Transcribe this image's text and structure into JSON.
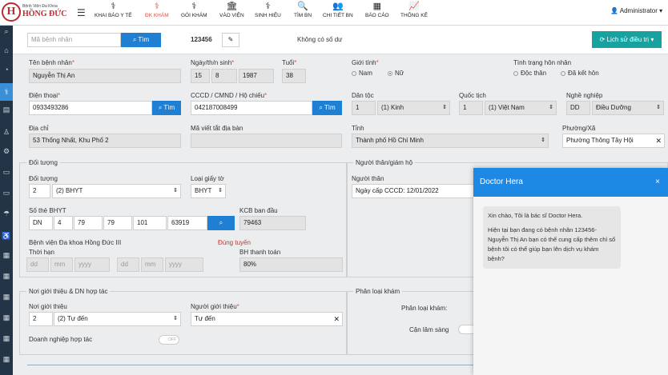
{
  "header": {
    "logo_letter": "H",
    "logo_line1": "Bệnh Viện Đa Khoa",
    "logo_line2": "HỒNG ĐỨC",
    "nav": [
      {
        "label": "KHAI BÁO Y TẾ",
        "icon": "stethoscope-icon",
        "glyph": "⚕"
      },
      {
        "label": "ĐK KHÁM",
        "icon": "stethoscope-icon",
        "glyph": "⚕"
      },
      {
        "label": "GÓI KHÁM",
        "icon": "stethoscope-icon",
        "glyph": "⚕"
      },
      {
        "label": "VÀO VIỆN",
        "icon": "hospital-icon",
        "glyph": "🏛"
      },
      {
        "label": "SINH HIỆU",
        "icon": "stethoscope-icon",
        "glyph": "⚕"
      },
      {
        "label": "TÌM BN",
        "icon": "search-icon",
        "glyph": "🔍"
      },
      {
        "label": "CHI TIẾT BN",
        "icon": "users-icon",
        "glyph": "👥"
      },
      {
        "label": "BÁO CÁO",
        "icon": "report-icon",
        "glyph": "▦"
      },
      {
        "label": "THỐNG KÊ",
        "icon": "chart-icon",
        "glyph": "📈"
      }
    ],
    "user": "Administrator"
  },
  "toolbar": {
    "patient_search_placeholder": "Mã bệnh nhân",
    "search_label": "Tìm",
    "patient_code": "123456",
    "balance_text": "Không có số dư",
    "history_label": "Lịch sử điều trị"
  },
  "patient": {
    "name_label": "Tên bệnh nhân",
    "name": "Nguyễn Thị An",
    "dob_label": "Ngày/th/n sinh",
    "dob_day": "15",
    "dob_month": "8",
    "dob_year": "1987",
    "age_label": "Tuổi",
    "age": "38",
    "gender_label": "Giới tính",
    "gender_male": "Nam",
    "gender_female": "Nữ",
    "marital_label": "Tình trạng hôn nhân",
    "marital_single": "Độc thân",
    "marital_married": "Đã kết hôn",
    "phone_label": "Điện thoại",
    "phone": "0933493286",
    "id_label": "CCCD / CMND / Hộ chiếu",
    "id_number": "042187008499",
    "ethnic_label": "Dân tộc",
    "ethnic_code": "1",
    "ethnic_name": "(1) Kinh",
    "nationality_label": "Quốc tịch",
    "nationality_code": "1",
    "nationality_name": "(1) Việt Nam",
    "job_label": "Nghề nghiệp",
    "job_code": "DD",
    "job_name": "Điều Dưỡng",
    "address_label": "Địa chỉ",
    "address": "53 Thống Nhất, Khu Phố 2",
    "area_code_label": "Mã viết tắt địa bàn",
    "province_label": "Tỉnh",
    "province": "Thành phố Hồ Chí Minh",
    "ward_label": "Phường/Xã",
    "ward": "Phường Thông Tây Hội"
  },
  "insurance": {
    "section": "Đối tượng",
    "type_label": "Đối tượng",
    "type_code": "2",
    "type_name": "(2) BHYT",
    "doc_type_label": "Loại giấy tờ",
    "doc_type": "BHYT",
    "card_label": "Số thẻ BHYT",
    "card_parts": [
      "DN",
      "4",
      "79",
      "79",
      "101",
      "63919"
    ],
    "kcb_label": "KCB ban đầu",
    "kcb": "79463",
    "hospital_name": "Bệnh viện Đa khoa Hồng Đức III",
    "route": "Đúng tuyến",
    "validity_label": "Thời hạn",
    "date_ph": [
      "dd",
      "mm",
      "yyyy",
      "dd",
      "mm",
      "yyyy"
    ],
    "pay_label": "BH thanh toán",
    "pay": "80%"
  },
  "relative": {
    "section": "Người thân/giám hộ",
    "label": "Người thân",
    "value": "Ngày cấp CCCD: 12/01/2022"
  },
  "referral": {
    "section": "Nơi giới thiệu & DN hợp tác",
    "source_label": "Nơi giới thiệu",
    "source_code": "2",
    "source_name": "(2) Tự đến",
    "person_label": "Người giới thiệu",
    "person": "Tự đến",
    "partner_label": "Doanh nghiệp hợp tác",
    "toggle": "OFF"
  },
  "classify": {
    "section": "Phân loại khám",
    "type_label": "Phân loại khám:",
    "lab_label": "Cận lâm sàng"
  },
  "chat": {
    "title": "Doctor Hera",
    "close": "×",
    "greeting": "Xin chào, Tôi là bác sĩ Doctor Hera.",
    "message": "Hiện tại bạn đang có bệnh nhân 123456-Nguyễn Thị An bạn có thể cung cấp thêm chỉ số bệnh tôi có thể giúp bạn lên dịch vụ khám bệnh?"
  },
  "colors": {
    "primary": "#1e7fd3",
    "accent": "#e44b3a",
    "teal": "#17a2a0",
    "sidebar": "#243447"
  }
}
